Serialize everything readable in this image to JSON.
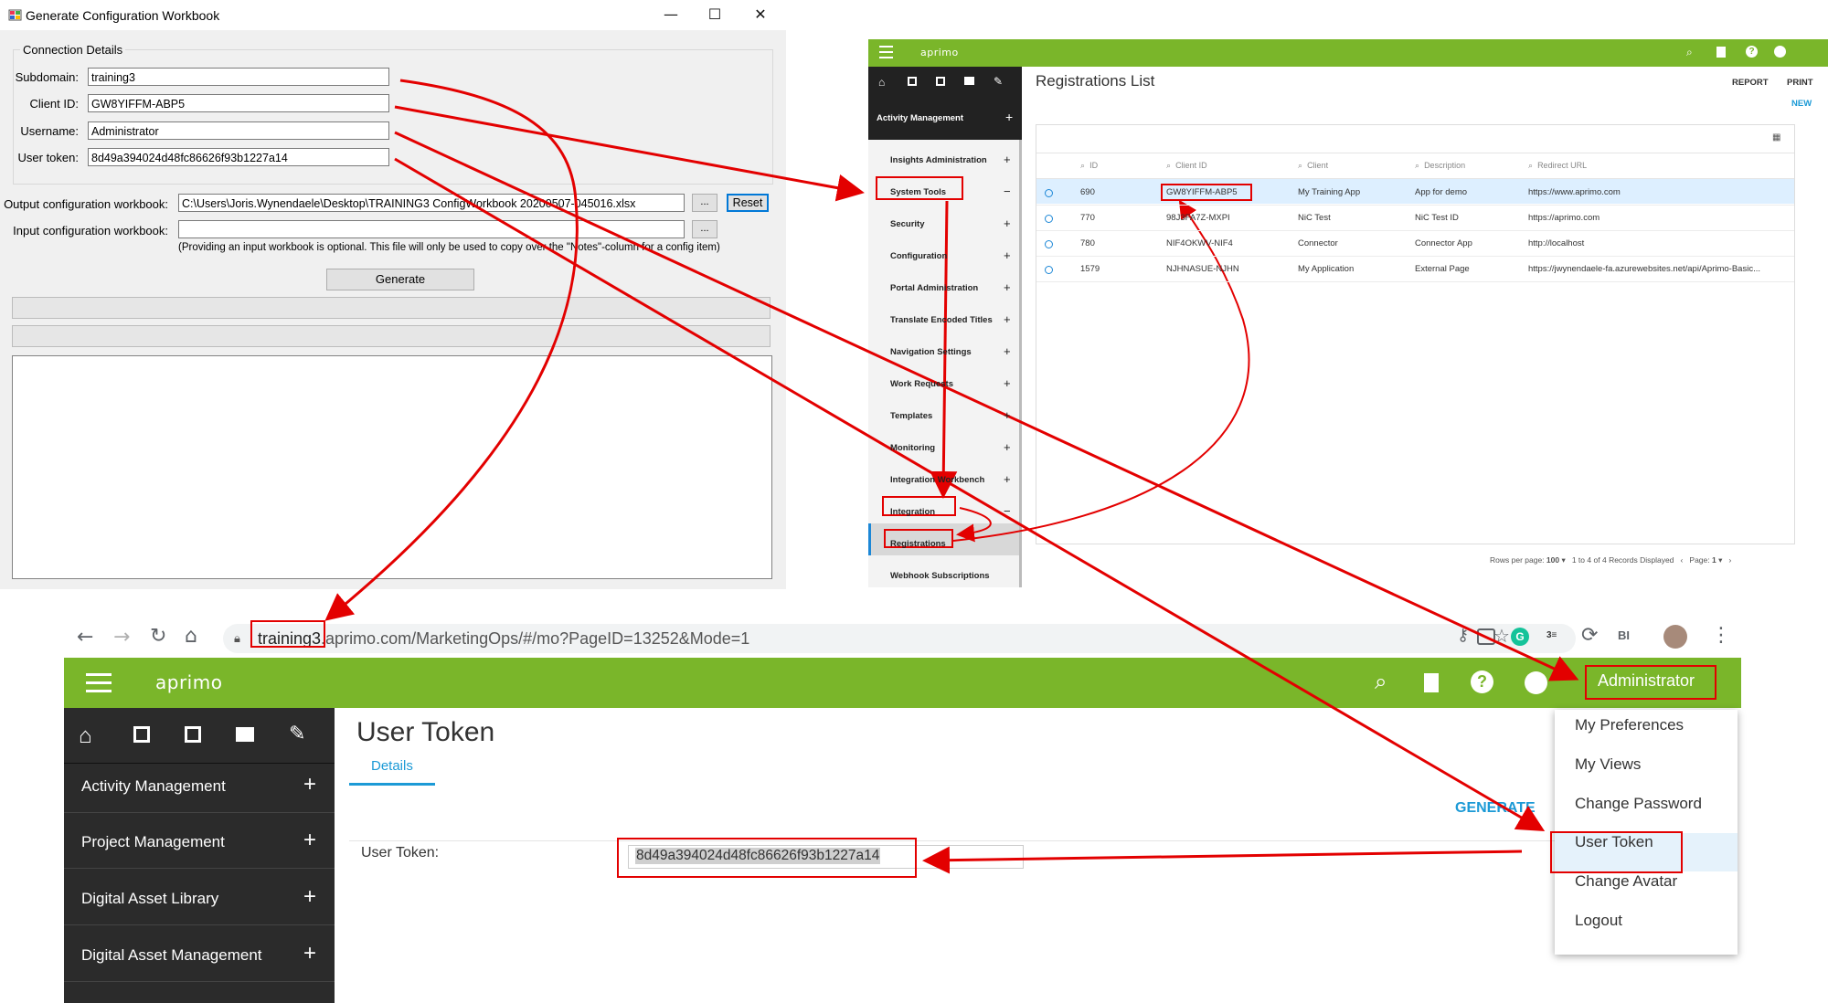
{
  "winform": {
    "title": "Generate Configuration Workbook",
    "minimize": "—",
    "maximize": "☐",
    "close": "✕",
    "group_label": "Connection Details",
    "subdomain_label": "Subdomain:",
    "subdomain_value": "training3",
    "clientid_label": "Client ID:",
    "clientid_value": "GW8YIFFM-ABP5",
    "username_label": "Username:",
    "username_value": "Administrator",
    "usertoken_label": "User token:",
    "usertoken_value": "8d49a394024d48fc86626f93b1227a14",
    "output_label": "Output configuration workbook:",
    "output_value": "C:\\Users\\Joris.Wynendaele\\Desktop\\TRAINING3 ConfigWorkbook 20200507-045016.xlsx",
    "browse_label": "...",
    "reset_label": "Reset",
    "input_label": "Input configuration workbook:",
    "input_value": "",
    "input_note": "(Providing an input workbook is optional. This file will only be used to copy over the \"Notes\"-column for a config item)",
    "generate_label": "Generate"
  },
  "admin": {
    "logo": "aprimo",
    "sidebar_section": "Activity Management",
    "sidebar_items": [
      {
        "label": "Insights Administration",
        "sign": "+"
      },
      {
        "label": "System Tools",
        "sign": "−"
      },
      {
        "label": "Security",
        "sign": "+"
      },
      {
        "label": "Configuration",
        "sign": "+"
      },
      {
        "label": "Portal Administration",
        "sign": "+"
      },
      {
        "label": "Translate Encoded Titles",
        "sign": "+"
      },
      {
        "label": "Navigation Settings",
        "sign": "+"
      },
      {
        "label": "Work Requests",
        "sign": "+"
      },
      {
        "label": "Templates",
        "sign": "+"
      },
      {
        "label": "Monitoring",
        "sign": "+"
      },
      {
        "label": "Integration Workbench",
        "sign": "+"
      },
      {
        "label": "Integration",
        "sign": "−"
      },
      {
        "label": "Registrations",
        "sign": ""
      },
      {
        "label": "Webhook Subscriptions",
        "sign": ""
      }
    ],
    "page_title": "Registrations List",
    "report": "REPORT",
    "print": "PRINT",
    "new": "NEW",
    "columns": [
      "ID",
      "Client ID",
      "Client",
      "Description",
      "Redirect URL"
    ],
    "rows": [
      {
        "id": "690",
        "client_id": "GW8YIFFM-ABP5",
        "client": "My Training App",
        "description": "App for demo",
        "url": "https://www.aprimo.com"
      },
      {
        "id": "770",
        "client_id": "98J3FA7Z-MXPI",
        "client": "NiC Test",
        "description": "NiC Test ID",
        "url": "https://aprimo.com"
      },
      {
        "id": "780",
        "client_id": "NIF4OKWV-NIF4",
        "client": "Connector",
        "description": "Connector App",
        "url": "http://localhost"
      },
      {
        "id": "1579",
        "client_id": "NJHNASUE-NJHN",
        "client": "My Application",
        "description": "External Page",
        "url": "https://jwynendaele-fa.azurewebsites.net/api/Aprimo-Basic..."
      }
    ],
    "footer": {
      "rows_per_page_label": "Rows per page:",
      "rows_per_page": "100",
      "range": "1 to 4",
      "of": "of",
      "total": "4",
      "records": "Records Displayed",
      "page_label": "Page:",
      "page": "1"
    }
  },
  "browser": {
    "url_highlight": "training3",
    "url_rest": ".aprimo.com/MarketingOps/#/mo?PageID=13252&Mode=1",
    "logo": "aprimo",
    "user": "Administrator",
    "sidebar_items": [
      "Activity Management",
      "Project Management",
      "Digital Asset Library",
      "Digital Asset Management"
    ],
    "page_title": "User Token",
    "tab": "Details",
    "generate": "GENERATE",
    "token_label": "User Token:",
    "token_value": "8d49a394024d48fc86626f93b1227a14",
    "menu": [
      "My Preferences",
      "My Views",
      "Change Password",
      "User Token",
      "Change Avatar",
      "Logout"
    ]
  },
  "colors": {
    "aprimo_green": "#7ab62a",
    "annotation_red": "#e30000",
    "link_blue": "#1c9ad6"
  }
}
